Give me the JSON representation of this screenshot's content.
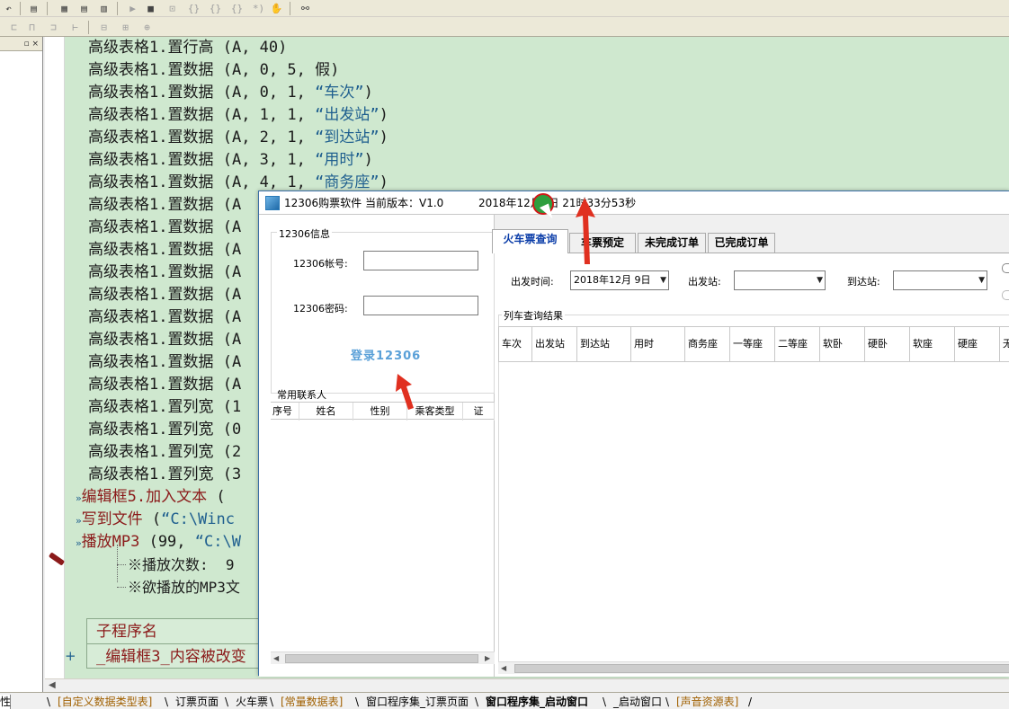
{
  "toolbar": {
    "row1_icons": [
      "undo-icon",
      "find-icon",
      "layout1-icon",
      "layout2-icon",
      "layout3-icon",
      "run-icon",
      "stop-icon",
      "step-icon",
      "step-into-icon",
      "step-out-icon",
      "break-icon",
      "hand-icon",
      "binoculars-icon"
    ],
    "row2_icons": [
      "align-left-icon",
      "align-center-icon",
      "align-right-icon",
      "spacing-icon",
      "width-icon",
      "height-icon",
      "grid-icon"
    ]
  },
  "left_panel": {
    "controls": "▫ ×"
  },
  "editor": {
    "lines": [
      {
        "obj": "高级表格1.",
        "method": "置行高",
        "args": " (A, 40)"
      },
      {
        "obj": "高级表格1.",
        "method": "置数据",
        "args": " (A, 0, 5, 假)"
      },
      {
        "obj": "高级表格1.",
        "method": "置数据",
        "args": " (A, 0, 1, ",
        "str": "“车次”",
        "tail": ")"
      },
      {
        "obj": "高级表格1.",
        "method": "置数据",
        "args": " (A, 1, 1, ",
        "str": "“出发站”",
        "tail": ")"
      },
      {
        "obj": "高级表格1.",
        "method": "置数据",
        "args": " (A, 2, 1, ",
        "str": "“到达站”",
        "tail": ")"
      },
      {
        "obj": "高级表格1.",
        "method": "置数据",
        "args": " (A, 3, 1, ",
        "str": "“用时”",
        "tail": ")"
      },
      {
        "obj": "高级表格1.",
        "method": "置数据",
        "args": " (A, 4, 1, ",
        "str": "“商务座”",
        "tail": ")"
      },
      {
        "obj": "高级表格1.",
        "method": "置数据",
        "args": " (A"
      },
      {
        "obj": "高级表格1.",
        "method": "置数据",
        "args": " (A"
      },
      {
        "obj": "高级表格1.",
        "method": "置数据",
        "args": " (A"
      },
      {
        "obj": "高级表格1.",
        "method": "置数据",
        "args": " (A"
      },
      {
        "obj": "高级表格1.",
        "method": "置数据",
        "args": " (A"
      },
      {
        "obj": "高级表格1.",
        "method": "置数据",
        "args": " (A"
      },
      {
        "obj": "高级表格1.",
        "method": "置数据",
        "args": " (A"
      },
      {
        "obj": "高级表格1.",
        "method": "置数据",
        "args": " (A"
      },
      {
        "obj": "高级表格1.",
        "method": "置数据",
        "args": " (A"
      },
      {
        "obj": "高级表格1.",
        "method": "置列宽",
        "args": " (1"
      },
      {
        "obj": "高级表格1.",
        "method": "置列宽",
        "args": " (0"
      },
      {
        "obj": "高级表格1.",
        "method": "置列宽",
        "args": " (2"
      },
      {
        "obj": "高级表格1.",
        "method": "置列宽",
        "args": " (3"
      }
    ],
    "cmd_lines": [
      {
        "marker": "»",
        "name": "编辑框5.加入文本",
        "rest": " ("
      },
      {
        "marker": "»",
        "name": "写到文件",
        "rest": " (",
        "str": "“C:\\Winc"
      },
      {
        "marker": "»",
        "name": "播放MP3",
        "rest": " (99, ",
        "str": "“C:\\W"
      }
    ],
    "sub_lines": [
      "※播放次数:  9",
      "※欲播放的MP3文"
    ],
    "subtable": {
      "header": "子程序名",
      "row": "_编辑框3_内容被改变",
      "plus": "+"
    }
  },
  "bottom_tabs": [
    {
      "label": "[自定义数据类型表]",
      "style": "res"
    },
    {
      "label": "订票页面",
      "style": ""
    },
    {
      "label": "火车票",
      "style": ""
    },
    {
      "label": "[常量数据表]",
      "style": "res"
    },
    {
      "label": "窗口程序集_订票页面",
      "style": ""
    },
    {
      "label": "窗口程序集_启动窗口",
      "style": "bold"
    },
    {
      "label": "_启动窗口",
      "style": ""
    },
    {
      "label": "[声音资源表]",
      "style": "res"
    }
  ],
  "bottom_left_label": "性",
  "app": {
    "title": "12306购票软件 当前版本：V1.0",
    "datetime": "2018年12月9日 21时33分53秒",
    "login": {
      "group_title": "12306信息",
      "account_label": "12306帐号:",
      "account_value": "",
      "password_label": "12306密码:",
      "password_value": "",
      "login_button": "登录12306",
      "contacts_label": "常用联系人",
      "contacts_columns": [
        "序号",
        "姓名",
        "性别",
        "乘客类型",
        "证"
      ]
    },
    "tabs": [
      {
        "label": "火车票查询",
        "active": true
      },
      {
        "label": "车票预定",
        "active": false
      },
      {
        "label": "未完成订单",
        "active": false
      },
      {
        "label": "已完成订单",
        "active": false
      }
    ],
    "query": {
      "depart_time_label": "出发时间:",
      "depart_time_value": "2018年12月 9日",
      "from_label": "出发站:",
      "from_value": "",
      "to_label": "到达站:",
      "to_value": "",
      "results_title": "列车查询结果",
      "results_columns": [
        "车次",
        "出发站",
        "到达站",
        "用时",
        "商务座",
        "一等座",
        "二等座",
        "软卧",
        "硬卧",
        "软座",
        "硬座",
        "无"
      ]
    }
  },
  "annotations": {
    "arrow_color": "#e03020",
    "cursor_marker_color": "#2e9e3e"
  }
}
